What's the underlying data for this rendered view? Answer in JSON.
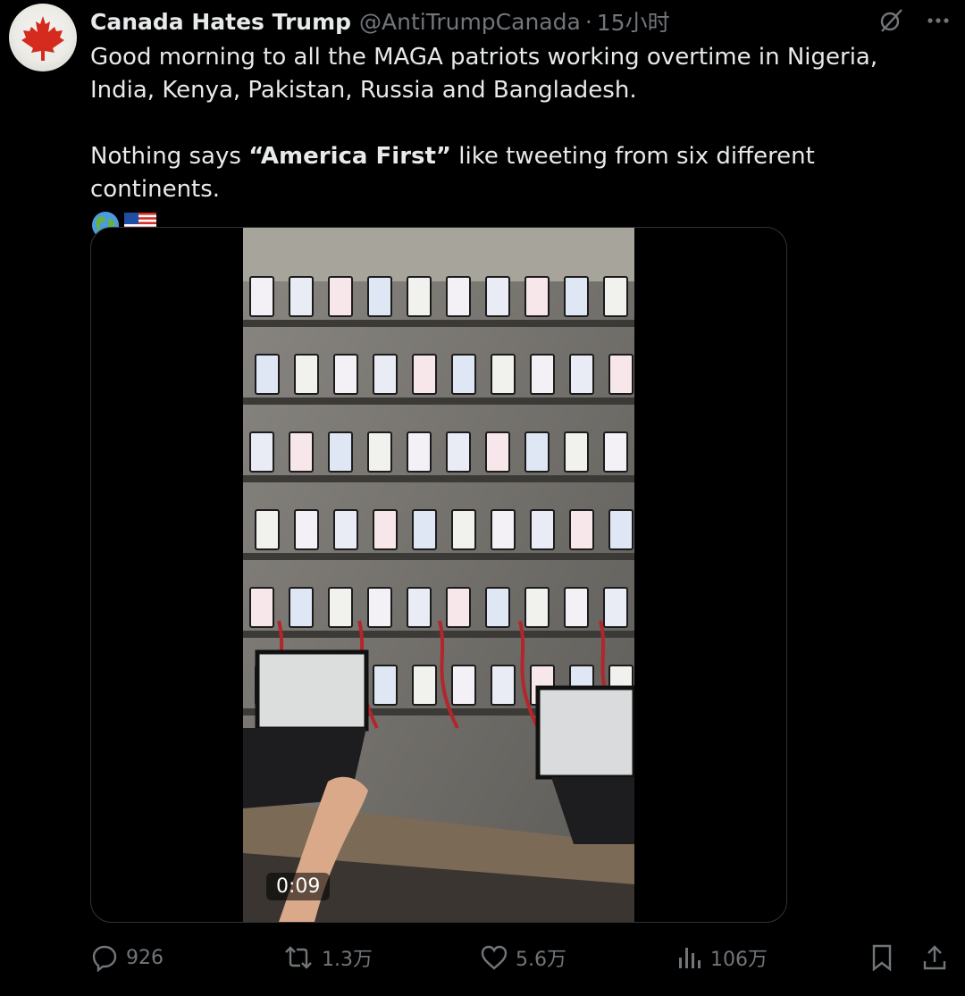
{
  "tweet": {
    "author_name": "Canada Hates Trump",
    "handle": "@AntiTrumpCanada",
    "separator": "·",
    "time": "15小时",
    "avatar_icon": "maple-leaf-icon",
    "text": {
      "line1": "Good morning to all the MAGA patriots working overtime in Nigeria, India, Kenya, Pakistan, Russia and Bangladesh.",
      "line2_before": "Nothing says ",
      "line2_bold": "“America First”",
      "line2_after": " like tweeting from six different continents."
    },
    "emojis": [
      "globe-africa-europe-emoji",
      "us-flag-emoji"
    ]
  },
  "media": {
    "type": "video",
    "duration": "0:09"
  },
  "actions": {
    "replies": "926",
    "reposts": "1.3万",
    "likes": "5.6万",
    "views": "106万"
  },
  "colors": {
    "background": "#000000",
    "text": "#e7e9ea",
    "muted": "#71767b",
    "border": "#2f3336",
    "avatar_leaf": "#d52b1e"
  }
}
